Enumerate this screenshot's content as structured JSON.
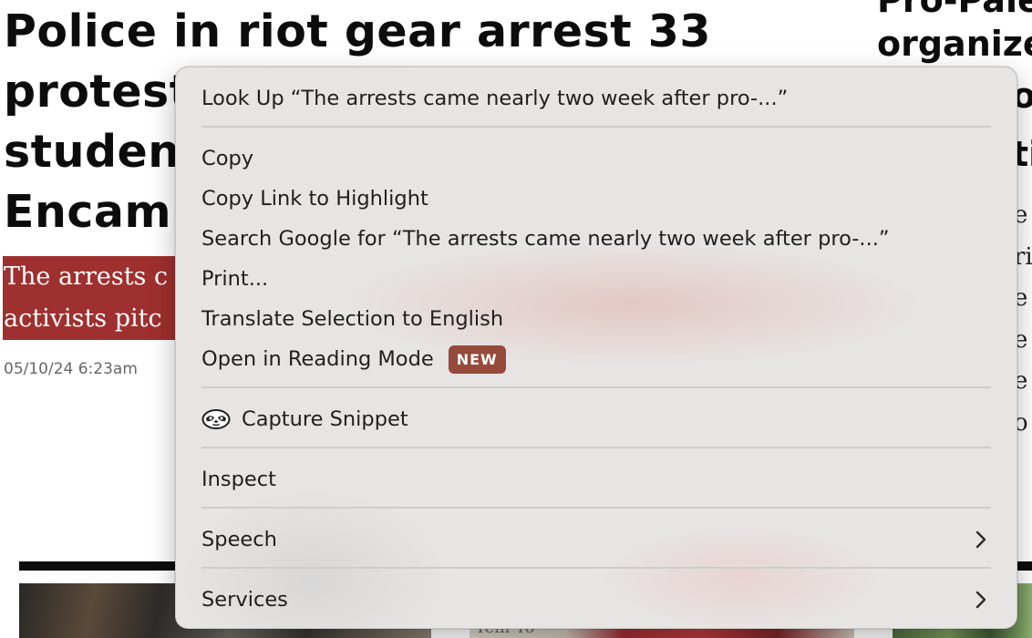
{
  "article": {
    "headline_lines": [
      "Police in riot gear arrest 33",
      "proteste",
      "student",
      "Encamp"
    ],
    "dek_lines": [
      "The arrests c",
      "activists pitc"
    ],
    "timestamp": "05/10/24 6:23am"
  },
  "side_article": {
    "headline_lines": [
      "Pro-Pale",
      "organize",
      "o",
      "ti"
    ],
    "body_lines": [
      "e",
      "ri",
      "e",
      "e",
      "e",
      "o"
    ]
  },
  "thumbnails": {
    "sign_text": "Tem    To"
  },
  "context_menu": {
    "look_up": "Look Up “The arrests came nearly two week after pro-...”",
    "copy": "Copy",
    "copy_link": "Copy Link to Highlight",
    "search_google": "Search Google for “The arrests came nearly two week after pro-...”",
    "print": "Print...",
    "translate": "Translate Selection to English",
    "reading_mode": "Open in Reading Mode",
    "reading_mode_badge": "NEW",
    "capture_snippet": "Capture Snippet",
    "inspect": "Inspect",
    "speech": "Speech",
    "services": "Services"
  },
  "icons": {
    "snippet": "sloth-face-icon",
    "submenu": "chevron-right-icon"
  },
  "colors": {
    "dek_background": "#9e302f",
    "badge_background": "#954a3a",
    "menu_background": "#e7e5e4"
  }
}
